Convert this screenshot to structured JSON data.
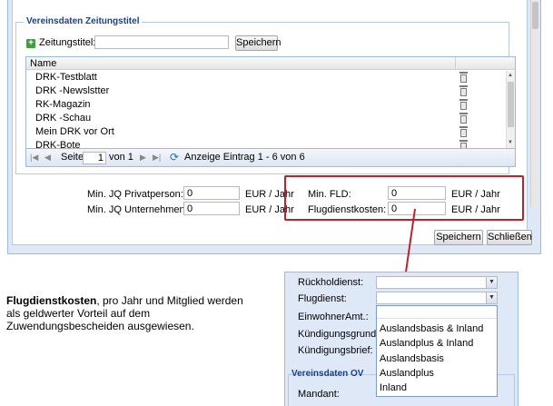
{
  "dialog": {
    "fieldset_title": "Vereinsdaten Zeitungstitel",
    "zeitungstitel_label": "Zeitungstitel:",
    "zeitungstitel_value": "",
    "add_save_label": "Speichern",
    "grid": {
      "column_name": "Name",
      "rows": [
        "DRK-Testblatt",
        "DRK -Newslstter",
        "RK-Magazin",
        "DRK -Schau",
        "Mein DRK vor Ort",
        "DRK-Bote"
      ]
    },
    "paging": {
      "first": "|◀",
      "prev": "◀",
      "page_label": "Seite",
      "page_value": "1",
      "of_label": "von 1",
      "next": "▶",
      "last": "▶|",
      "info": "Anzeige Eintrag 1 - 6 von 6"
    },
    "fields": {
      "privat_label": "Min. JQ Privatperson:",
      "privat_value": "0",
      "privat_unit": "EUR / Jahr",
      "unternehmen_label": "Min. JQ Unternehmen:",
      "unternehmen_value": "0",
      "unternehmen_unit": "EUR / Jahr",
      "fld_label": "Min. FLD:",
      "fld_value": "0",
      "fld_unit": "EUR / Jahr",
      "flug_label": "Flugdienstkosten:",
      "flug_value": "0",
      "flug_unit": "EUR / Jahr"
    },
    "save_label": "Speichern",
    "close_label": "Schließen"
  },
  "caption": {
    "bold": "Flugdienstkosten",
    "rest": ", pro Jahr und Mitglied werden als geldwerter Vorteil auf dem Zuwendungsbescheiden ausgewiesen."
  },
  "form2": {
    "rueckhol_label": "Rückholdienst:",
    "flugdienst_label": "Flugdienst:",
    "einwohner_label": "EinwohnerAmt.:",
    "kuendigungsgrund_label": "Kündigungsgrund:",
    "kuendigungsbrief_label": "Kündigungsbrief:",
    "options": [
      "Auslandsbasis & Inland",
      "Auslandplus & Inland",
      "Auslandsbasis",
      "Auslandplus",
      "Inland"
    ],
    "section_title": "Vereinsdaten OV",
    "mandant_label": "Mandant:"
  },
  "colors": {
    "highlight": "#c0202a",
    "panel_blue": "#dfe8f6",
    "title_blue": "#15428b"
  }
}
